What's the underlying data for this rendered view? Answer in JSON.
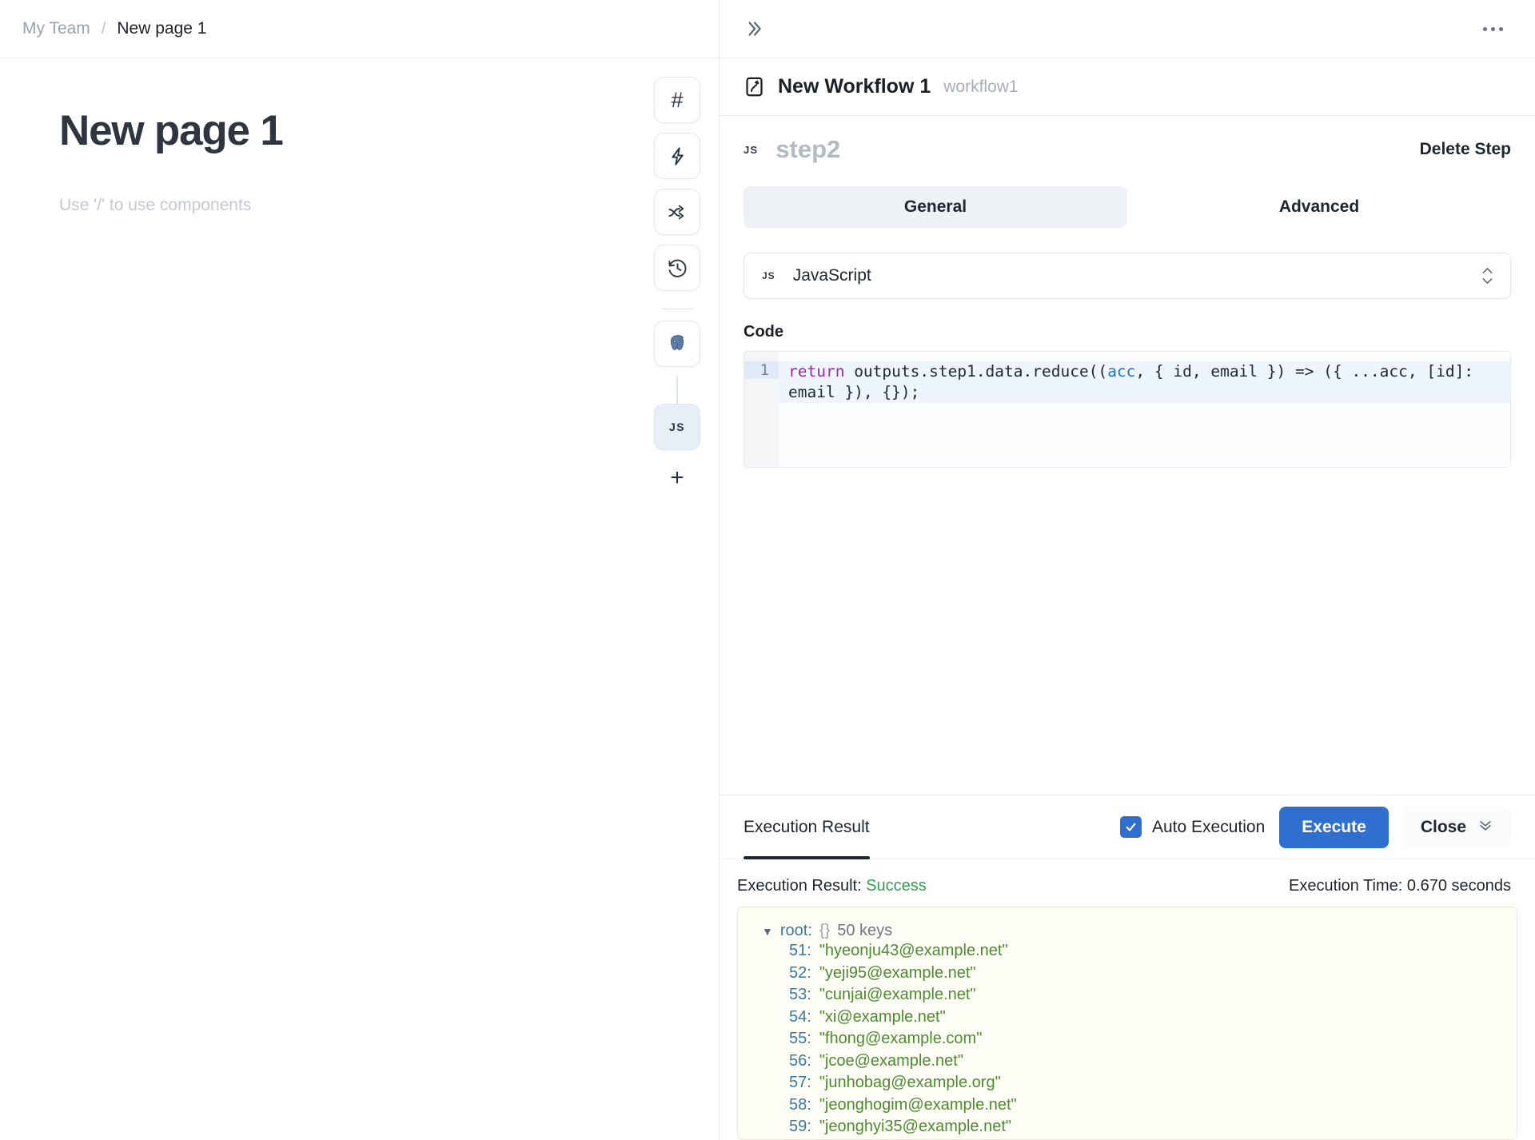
{
  "left_panel": {
    "breadcrumb": {
      "team": "My Team",
      "separator": "/",
      "page": "New page 1"
    },
    "document": {
      "title": "New page 1",
      "placeholder": "Use '/' to use components"
    },
    "rail": {
      "buttons": [
        {
          "name": "hash-icon",
          "label": "#"
        },
        {
          "name": "lightning-icon",
          "label": ""
        },
        {
          "name": "branch-icon",
          "label": ""
        },
        {
          "name": "history-icon",
          "label": ""
        }
      ],
      "nodes": [
        {
          "name": "postgres-node",
          "label": ""
        },
        {
          "name": "js-node",
          "label": "JS"
        }
      ],
      "add_label": "+"
    }
  },
  "right_panel": {
    "topbar": {
      "collapse_icon": "chevron-double-right-icon",
      "more_icon": "more-options-icon"
    },
    "workflow": {
      "icon": "workflow-icon",
      "name": "New Workflow 1",
      "slug": "workflow1"
    },
    "step": {
      "badge": "JS",
      "name": "step2",
      "delete_label": "Delete Step"
    },
    "tabs": [
      {
        "label": "General",
        "active": true
      },
      {
        "label": "Advanced",
        "active": false
      }
    ],
    "language_select": {
      "badge": "JS",
      "value": "JavaScript"
    },
    "code": {
      "label": "Code",
      "line_number": "1",
      "tokens": [
        {
          "type": "keyword",
          "text": "return"
        },
        {
          "type": "plain",
          "text": " outputs.step1.data.reduce(("
        },
        {
          "type": "variable",
          "text": "acc"
        },
        {
          "type": "plain",
          "text": ", { id, email }) => ({ ...acc, [id]: email }), {});"
        }
      ],
      "full_text": "return outputs.step1.data.reduce((acc, { id, email }) => ({ ...acc, [id]: email }), {});"
    },
    "execution": {
      "tab_label": "Execution Result",
      "auto_execution_label": "Auto Execution",
      "auto_execution_checked": true,
      "execute_label": "Execute",
      "close_label": "Close",
      "result_prefix": "Execution Result:",
      "result_status": "Success",
      "time_label": "Execution Time: 0.670 seconds",
      "json": {
        "root_label": "root:",
        "braces": "{}",
        "count": "50 keys",
        "entries": [
          {
            "key": "51:",
            "value": "\"hyeonju43@example.net\""
          },
          {
            "key": "52:",
            "value": "\"yeji95@example.net\""
          },
          {
            "key": "53:",
            "value": "\"cunjai@example.net\""
          },
          {
            "key": "54:",
            "value": "\"xi@example.net\""
          },
          {
            "key": "55:",
            "value": "\"fhong@example.com\""
          },
          {
            "key": "56:",
            "value": "\"jcoe@example.net\""
          },
          {
            "key": "57:",
            "value": "\"junhobag@example.org\""
          },
          {
            "key": "58:",
            "value": "\"jeonghogim@example.net\""
          },
          {
            "key": "59:",
            "value": "\"jeonghyi35@example.net\""
          }
        ]
      }
    }
  },
  "colors": {
    "accent_blue": "#2f6fd0",
    "success_green": "#2e9e4f",
    "json_key_blue": "#3b7a9e",
    "json_value_green": "#4e8a32",
    "keyword_purple": "#9c27b0",
    "variable_blue": "#1f6fd8"
  }
}
